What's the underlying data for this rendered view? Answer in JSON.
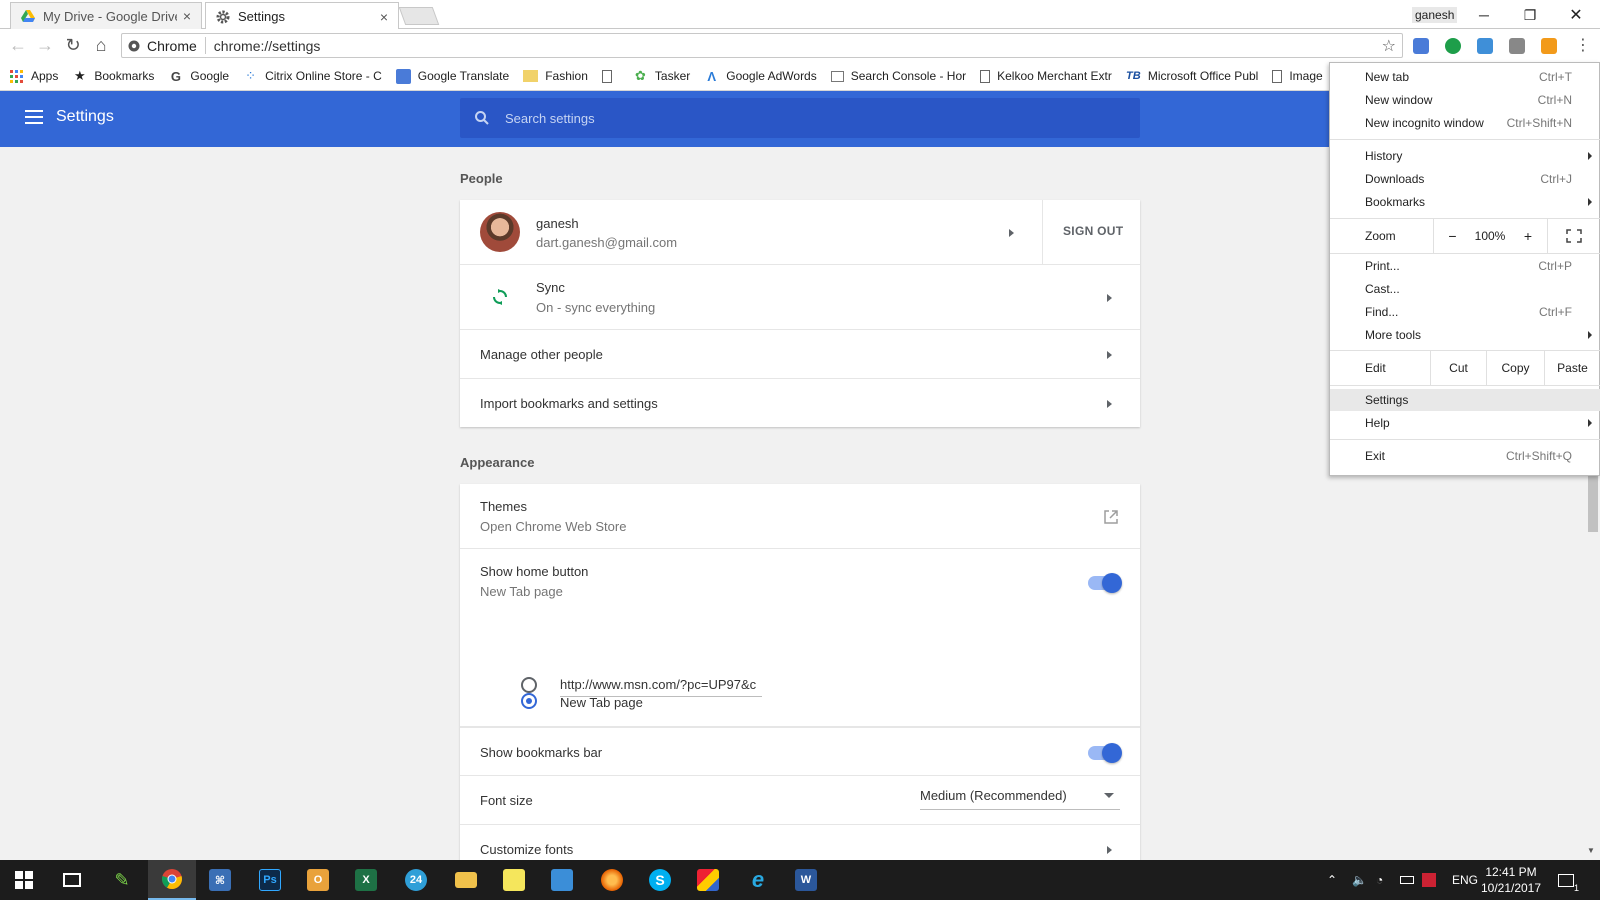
{
  "tabs": [
    {
      "label": "My Drive - Google Drive",
      "close": "×"
    },
    {
      "label": "Settings",
      "close": "×"
    }
  ],
  "window": {
    "user": "ganesh"
  },
  "omnibox": {
    "chip": "Chrome",
    "url": "chrome://settings"
  },
  "bookmarks": [
    "Apps",
    "Bookmarks",
    "Google",
    "Citrix Online Store - C",
    "Google Translate",
    "Fashion",
    "",
    "Tasker",
    "Google AdWords",
    "Search Console - Hor",
    "Kelkoo Merchant Extr",
    "Microsoft Office Publ",
    "Image"
  ],
  "header": {
    "title": "Settings",
    "search_placeholder": "Search settings"
  },
  "people": {
    "section": "People",
    "name": "ganesh",
    "email": "dart.ganesh@gmail.com",
    "sign_out": "SIGN OUT",
    "sync_title": "Sync",
    "sync_status": "On - sync everything",
    "manage": "Manage other people",
    "import": "Import bookmarks and settings"
  },
  "appearance": {
    "section": "Appearance",
    "themes": "Themes",
    "themes_sub": "Open Chrome Web Store",
    "home_button": "Show home button",
    "home_sub": "New Tab page",
    "home_button_on": true,
    "radio_newtab": "New Tab page",
    "radio_url": "http://www.msn.com/?pc=UP97&c",
    "bookmarks_bar": "Show bookmarks bar",
    "bookmarks_bar_on": true,
    "font_size_label": "Font size",
    "font_size_value": "Medium (Recommended)",
    "customize_fonts": "Customize fonts"
  },
  "menu": {
    "new_tab": "New tab",
    "new_tab_sc": "Ctrl+T",
    "new_window": "New window",
    "new_window_sc": "Ctrl+N",
    "incognito": "New incognito window",
    "incognito_sc": "Ctrl+Shift+N",
    "history": "History",
    "downloads": "Downloads",
    "downloads_sc": "Ctrl+J",
    "bookmarks": "Bookmarks",
    "zoom": "Zoom",
    "zoom_minus": "−",
    "zoom_value": "100%",
    "zoom_plus": "+",
    "print": "Print...",
    "print_sc": "Ctrl+P",
    "cast": "Cast...",
    "find": "Find...",
    "find_sc": "Ctrl+F",
    "more_tools": "More tools",
    "edit": "Edit",
    "cut": "Cut",
    "copy": "Copy",
    "paste": "Paste",
    "settings": "Settings",
    "help": "Help",
    "exit": "Exit",
    "exit_sc": "Ctrl+Shift+Q"
  },
  "taskbar": {
    "apps": [
      "windows-start",
      "task-view",
      "pen-app",
      "chrome",
      "network-app",
      "photoshop",
      "outlook",
      "excel",
      "clock-24-app",
      "file-explorer",
      "sticky-notes",
      "remote-desktop",
      "firefox",
      "skype",
      "paint-app",
      "internet-explorer",
      "word"
    ],
    "ps_label": "Ps",
    "skype_label": "S",
    "word_label": "W",
    "excel_label": "X",
    "outlook_label": "O",
    "badge_24": "24",
    "lang": "ENG",
    "time": "12:41 PM",
    "date": "10/21/2017",
    "notif_count": "1"
  },
  "colors": {
    "accent": "#3367d6",
    "header_search": "#2a56c6",
    "taskbar": "#1c1c1c"
  }
}
